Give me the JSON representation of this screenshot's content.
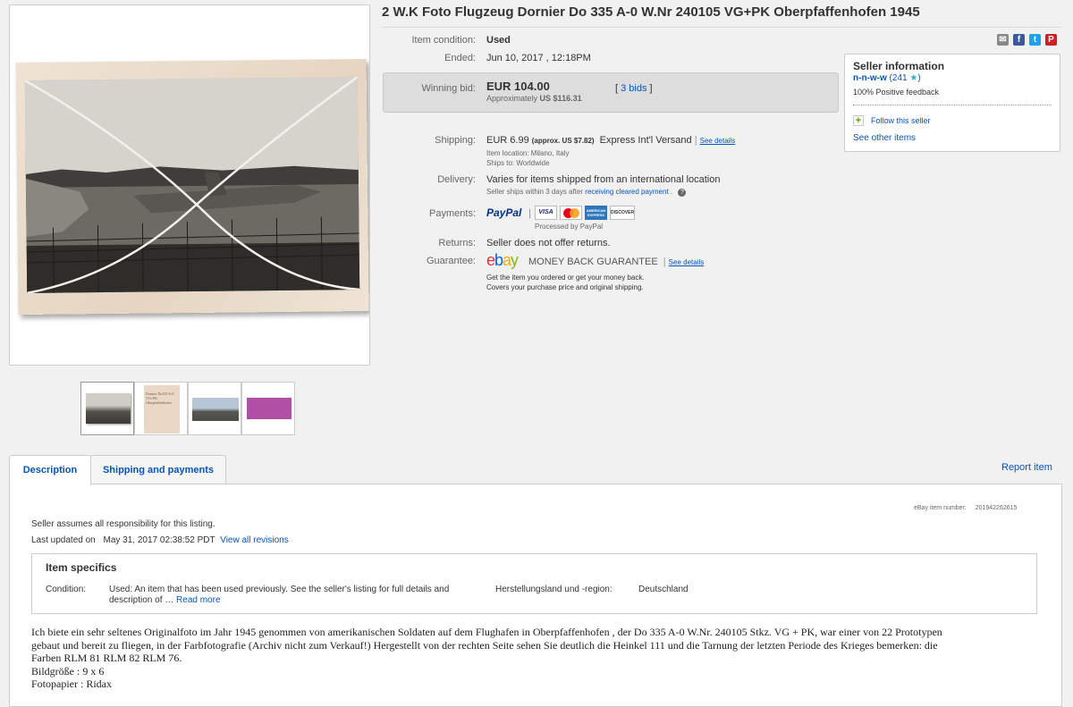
{
  "listing": {
    "title": "2 W.K Foto Flugzeug Dornier Do 335 A-0 W.Nr 240105 VG+PK Oberpfaffenhofen 1945"
  },
  "details": {
    "condition_label": "Item condition:",
    "condition_value": "Used",
    "ended_label": "Ended:",
    "ended_value": "Jun 10, 2017 , 12:18PM",
    "winning_label": "Winning bid:",
    "winning_value": "EUR 104.00",
    "approx_text": "Approximately",
    "approx_value": "US $116.31",
    "bids_open": "[",
    "bids_link": "3 bids",
    "bids_close": "]",
    "shipping_label": "Shipping:",
    "shipping_value": "EUR 6.99",
    "shipping_approx": "(approx. US $7.82)",
    "shipping_service": "Express Int'l Versand",
    "shipping_see": "See details",
    "item_location": "Item location:  Milano, Italy",
    "ships_to": "Ships to:  Worldwide",
    "delivery_label": "Delivery:",
    "delivery_value": "Varies for items shipped from an international location",
    "delivery_note": "Seller ships within 3 days after",
    "delivery_link": "receiving cleared payment",
    "delivery_end": ".",
    "help_icon": "?",
    "payments_label": "Payments:",
    "paypal_text": "PayPal",
    "visa_text": "VISA",
    "mc_text": "",
    "amex_text": "AMERICAN EXPRESS",
    "discover_text": "DISCOVER",
    "processed_by": "Processed by PayPal",
    "returns_label": "Returns:",
    "returns_value": "Seller does not offer returns.",
    "guarantee_label": "Guarantee:",
    "ebay_letters": [
      "e",
      "b",
      "a",
      "y"
    ],
    "guarantee_name": "MONEY BACK GUARANTEE",
    "guarantee_see": "See details",
    "guarantee_line1": "Get the item you ordered or get your money back.",
    "guarantee_line2": "Covers your purchase price and original shipping."
  },
  "seller": {
    "heading": "Seller information",
    "username": "n-n-w-w",
    "score": "(241",
    "score_close": ")",
    "feedback": "100% Positive feedback",
    "follow_icon": "+",
    "follow": "Follow this seller",
    "see_other": "See other items"
  },
  "tabs": {
    "description": "Description",
    "shipping": "Shipping and payments",
    "report": "Report item"
  },
  "description": {
    "item_number_label": "eBay item number:",
    "item_number": "201942262615",
    "responsibility": "Seller assumes all responsibility for this listing.",
    "last_updated_label": "Last updated on",
    "last_updated_value": "May 31, 2017 02:38:52 PDT",
    "view_revisions": "View all revisions",
    "specifics_heading": "Item specifics",
    "condition_label": "Condition:",
    "condition_text_1": "Used: An item that has been used previously. See the seller's listing for full details and",
    "condition_text_2": "description of …",
    "read_more": "Read more",
    "country_label": "Herstellungsland und -region:",
    "country_value": "Deutschland",
    "body_line1": "Ich biete ein sehr seltenes Originalfoto im Jahr 1945 genommen von amerikanischen Soldaten auf dem Flughafen in Oberpfaffenhofen , der Do 335 A-0 W.Nr. 240105 Stkz. VG + PK, war einer von 22 Prototypen",
    "body_line2": "gebaut und bereit zu fliegen, in der Farbfotografie (Archiv nicht zum Verkauf!) Hergestellt von der rechten Seite sehen Sie deutlich die Heinkel 111 und die Tarnung der letzten Periode des Krieges bemerken: die",
    "body_line3": "Farben RLM 81 RLM 82 RLM 76.",
    "body_line4": "Bildgröße : 9 x 6",
    "body_line5": "Fotopapier : Ridax"
  },
  "thumb_texts": {
    "thumb2_text": "Dornier Do335 A-0 VG+PK Oberpfaffenhofen"
  },
  "icons": {
    "share": [
      "envelope-icon",
      "facebook-icon",
      "twitter-icon",
      "pinterest-icon"
    ],
    "share_glyphs": [
      "✉",
      "f",
      "t",
      "P"
    ],
    "star_glyph": "★"
  },
  "colors": {
    "link": "#0654ba",
    "ebay_e": "#e53238",
    "ebay_b": "#0064d2",
    "ebay_a": "#f5af02",
    "ebay_y": "#86b817",
    "star": "#26b8c1"
  }
}
